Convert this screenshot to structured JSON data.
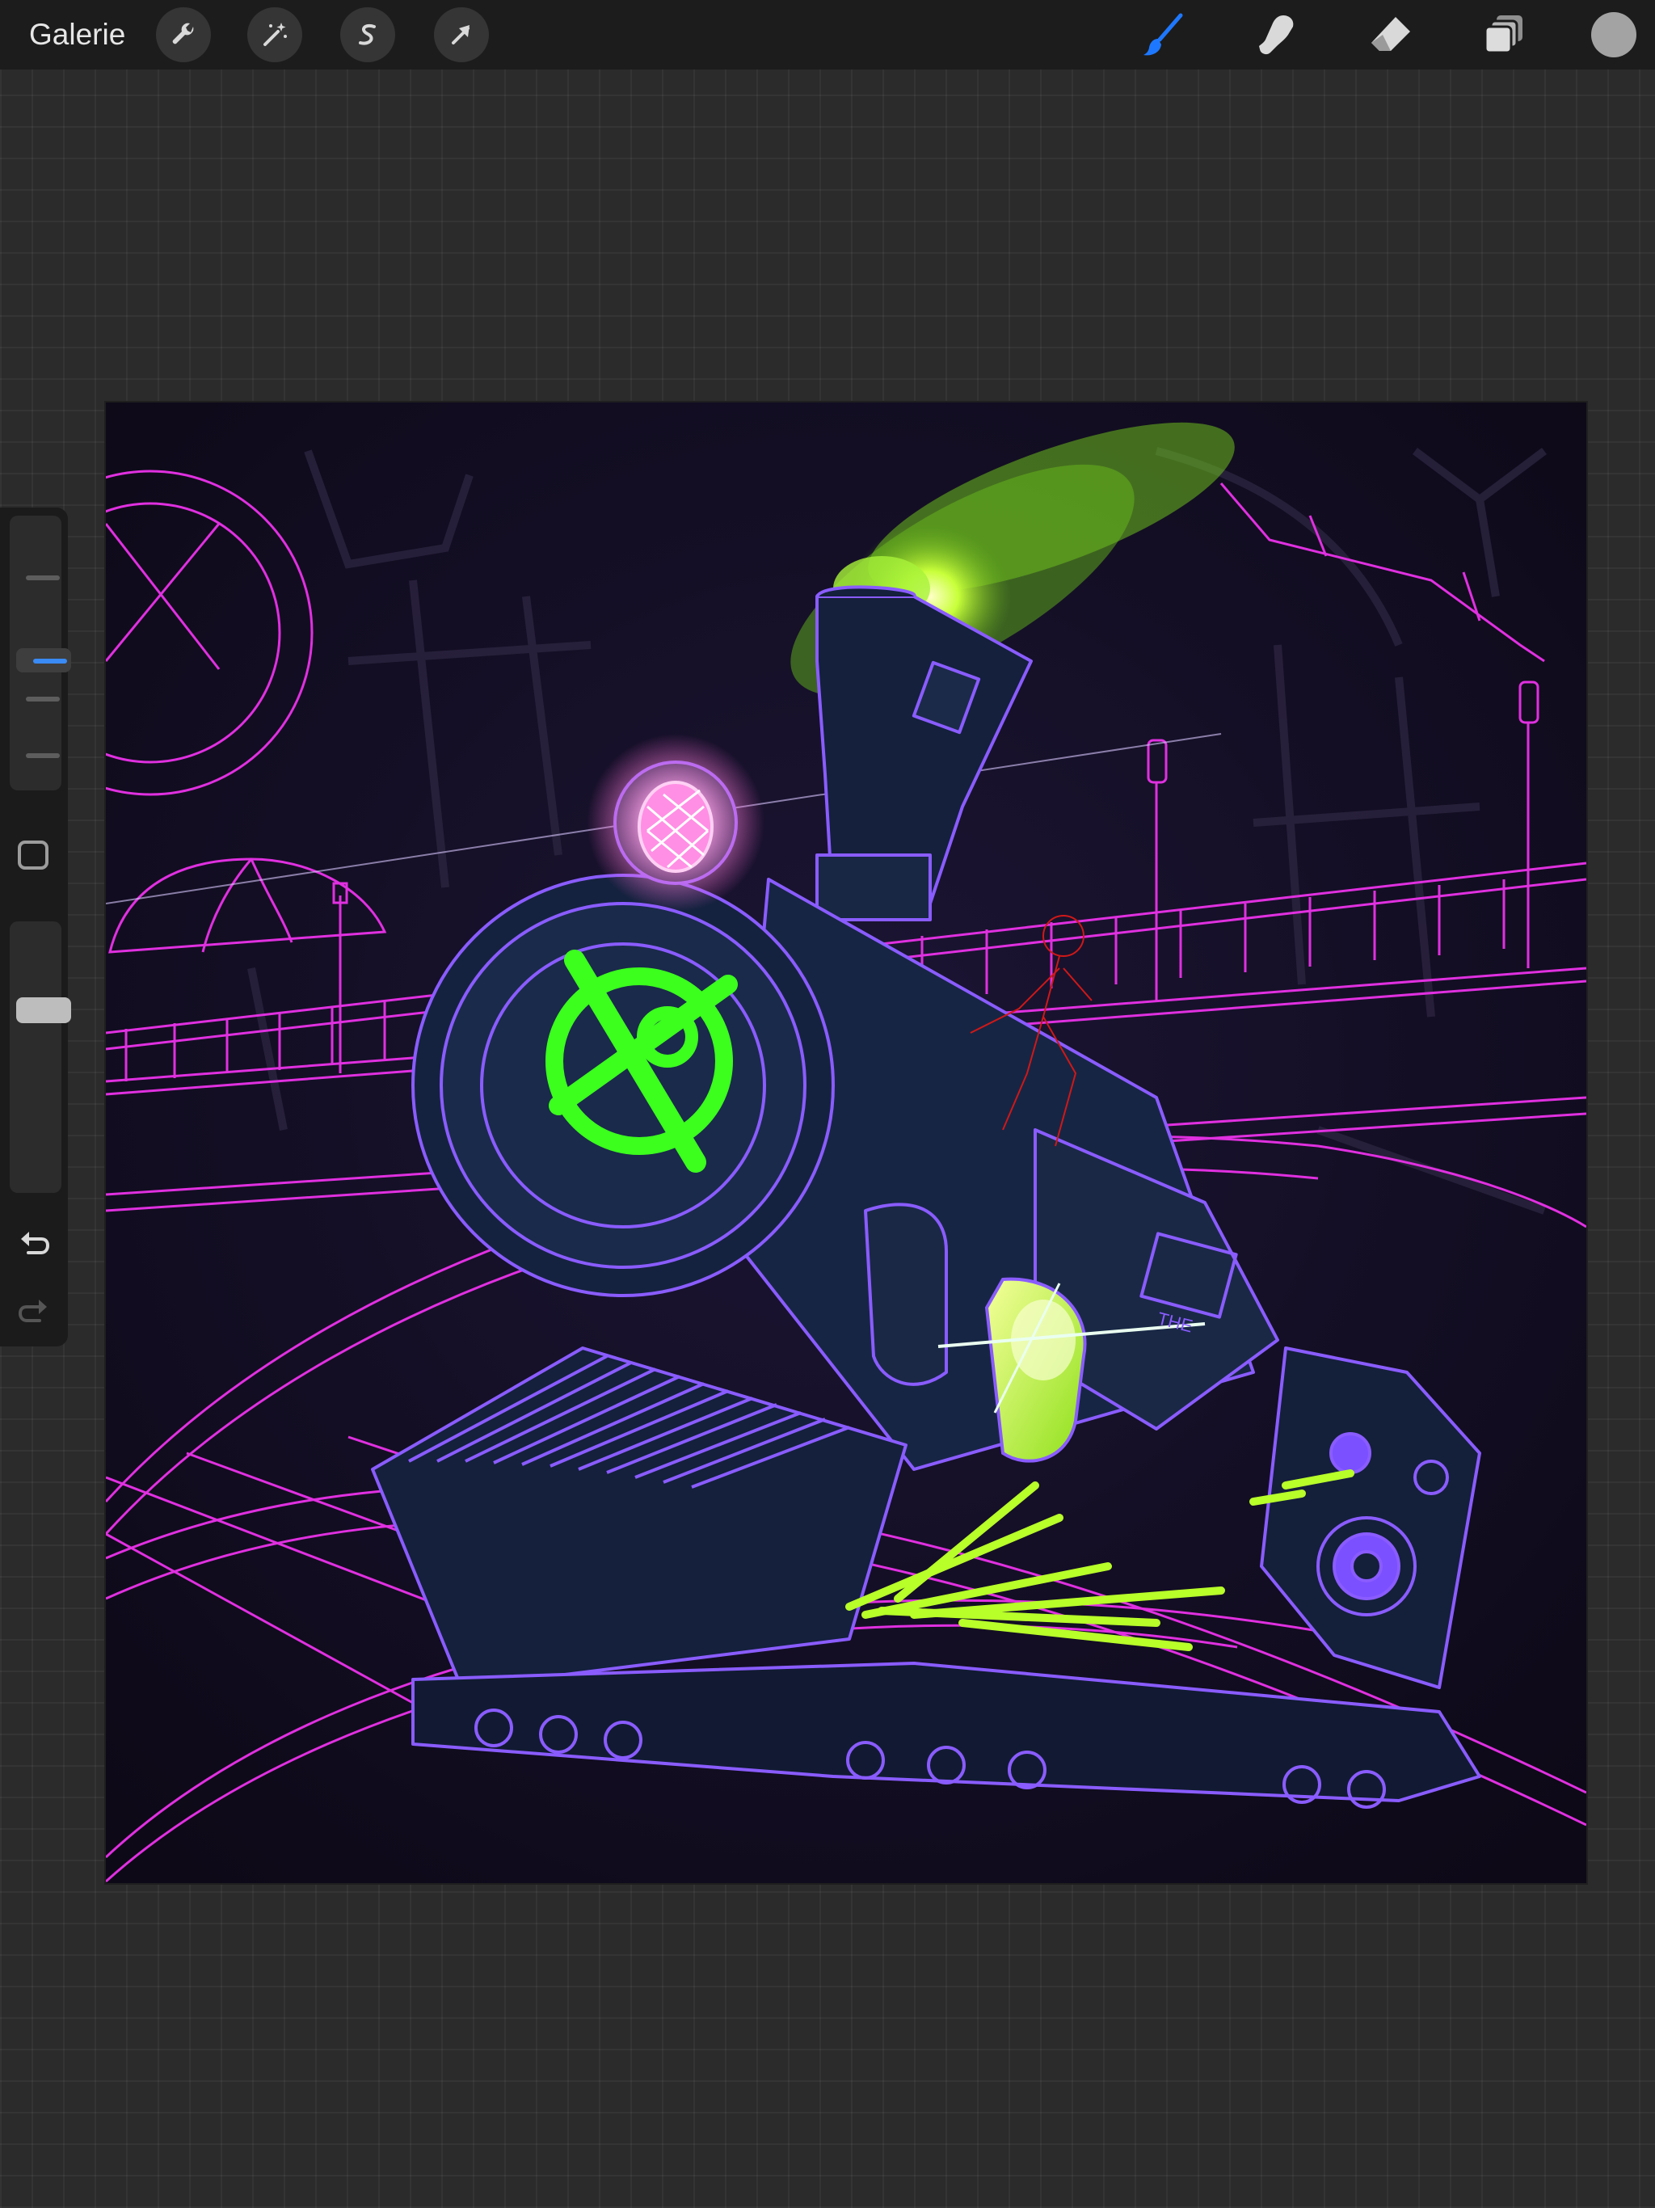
{
  "app": {
    "gallery_label": "Galerie"
  },
  "toolbar": {
    "left_tools": [
      "wrench-icon",
      "magic-wand-icon",
      "selection-s-icon",
      "transform-arrow-icon"
    ],
    "right_tools": [
      "brush-icon",
      "smudge-icon",
      "eraser-icon",
      "layers-icon"
    ],
    "active_tool": "brush",
    "active_color": "#1e78ff",
    "current_color": "#a3a3a3"
  },
  "sidebar": {
    "brush_size_level": 0.55,
    "brush_opacity_level": 1.0,
    "undo_enabled": true,
    "redo_enabled": false
  },
  "colors": {
    "background": "#2b2b2b",
    "topbar": "#1c1c1c",
    "neon_magenta": "#e030e0",
    "neon_violet": "#8a5cff",
    "neon_green": "#3cff1e",
    "lime": "#b8ff2a",
    "artwork_bg": "#120c1f"
  },
  "artwork": {
    "cab_text": "THE"
  }
}
